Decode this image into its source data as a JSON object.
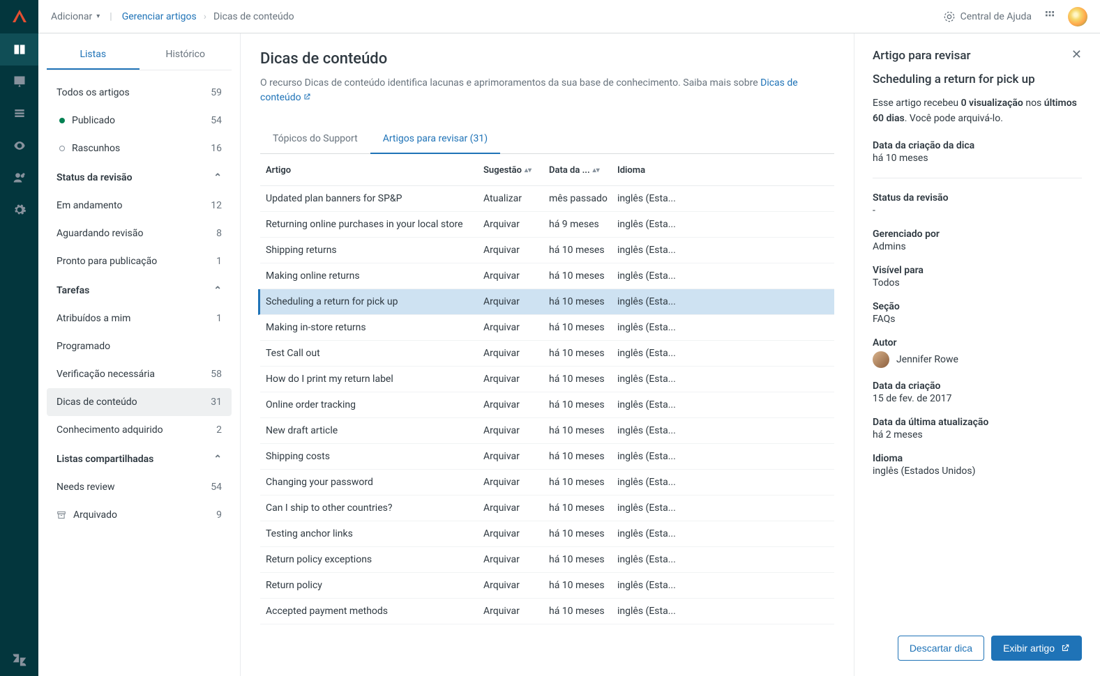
{
  "topbar": {
    "add": "Adicionar",
    "crumb_link": "Gerenciar artigos",
    "crumb_current": "Dicas de conteúdo",
    "help": "Central de Ajuda"
  },
  "sidebar": {
    "tab_lists": "Listas",
    "tab_history": "Histórico",
    "all": {
      "label": "Todos os artigos",
      "count": "59"
    },
    "published": {
      "label": "Publicado",
      "count": "54"
    },
    "drafts": {
      "label": "Rascunhos",
      "count": "16"
    },
    "group_review": "Status da revisão",
    "in_progress": {
      "label": "Em andamento",
      "count": "12"
    },
    "awaiting": {
      "label": "Aguardando revisão",
      "count": "8"
    },
    "ready": {
      "label": "Pronto para publicação",
      "count": "1"
    },
    "group_tasks": "Tarefas",
    "assigned": {
      "label": "Atribuídos a mim",
      "count": "1"
    },
    "scheduled": {
      "label": "Programado",
      "count": ""
    },
    "verify": {
      "label": "Verificação necessária",
      "count": "58"
    },
    "cues": {
      "label": "Dicas de conteúdo",
      "count": "31"
    },
    "acquired": {
      "label": "Conhecimento adquirido",
      "count": "2"
    },
    "group_shared": "Listas compartilhadas",
    "needs_review": {
      "label": "Needs review",
      "count": "54"
    },
    "archived": {
      "label": "Arquivado",
      "count": "9"
    }
  },
  "center": {
    "title": "Dicas de conteúdo",
    "desc_1": "O recurso Dicas de conteúdo identifica lacunas e aprimoramentos da sua base de conhecimento. Saiba mais sobre ",
    "desc_link": "Dicas de conteúdo",
    "tab_support": "Tópicos do Support",
    "tab_review": "Artigos para revisar (31)",
    "th_article": "Artigo",
    "th_suggestion": "Sugestão",
    "th_date": "Data da ...",
    "th_lang": "Idioma",
    "rows": [
      {
        "a": "Updated plan banners for SP&P",
        "s": "Atualizar",
        "d": "mês passado",
        "l": "inglês (Esta..."
      },
      {
        "a": "Returning online purchases in your local store",
        "s": "Arquivar",
        "d": "há 9 meses",
        "l": "inglês (Esta..."
      },
      {
        "a": "Shipping returns",
        "s": "Arquivar",
        "d": "há 10 meses",
        "l": "inglês (Esta..."
      },
      {
        "a": "Making online returns",
        "s": "Arquivar",
        "d": "há 10 meses",
        "l": "inglês (Esta..."
      },
      {
        "a": "Scheduling a return for pick up",
        "s": "Arquivar",
        "d": "há 10 meses",
        "l": "inglês (Esta...",
        "selected": true
      },
      {
        "a": "Making in-store returns",
        "s": "Arquivar",
        "d": "há 10 meses",
        "l": "inglês (Esta..."
      },
      {
        "a": "Test Call out",
        "s": "Arquivar",
        "d": "há 10 meses",
        "l": "inglês (Esta..."
      },
      {
        "a": "How do I print my return label",
        "s": "Arquivar",
        "d": "há 10 meses",
        "l": "inglês (Esta..."
      },
      {
        "a": "Online order tracking",
        "s": "Arquivar",
        "d": "há 10 meses",
        "l": "inglês (Esta..."
      },
      {
        "a": "New draft article",
        "s": "Arquivar",
        "d": "há 10 meses",
        "l": "inglês (Esta..."
      },
      {
        "a": "Shipping costs",
        "s": "Arquivar",
        "d": "há 10 meses",
        "l": "inglês (Esta..."
      },
      {
        "a": "Changing your password",
        "s": "Arquivar",
        "d": "há 10 meses",
        "l": "inglês (Esta..."
      },
      {
        "a": "Can I ship to other countries?",
        "s": "Arquivar",
        "d": "há 10 meses",
        "l": "inglês (Esta..."
      },
      {
        "a": "Testing anchor links",
        "s": "Arquivar",
        "d": "há 10 meses",
        "l": "inglês (Esta..."
      },
      {
        "a": "Return policy exceptions",
        "s": "Arquivar",
        "d": "há 10 meses",
        "l": "inglês (Esta..."
      },
      {
        "a": "Return policy",
        "s": "Arquivar",
        "d": "há 10 meses",
        "l": "inglês (Esta..."
      },
      {
        "a": "Accepted payment methods",
        "s": "Arquivar",
        "d": "há 10 meses",
        "l": "inglês (Esta..."
      }
    ]
  },
  "detail": {
    "panel_title": "Artigo para revisar",
    "article_title": "Scheduling a return for pick up",
    "p1_a": "Esse artigo recebeu ",
    "p1_b": "0 visualização",
    "p1_c": " nos ",
    "p1_d": "últimos 60 dias",
    "p1_e": ". Você pode arquivá-lo.",
    "f_created_cue": "Data da criação da dica",
    "v_created_cue": "há 10 meses",
    "f_review_status": "Status da revisão",
    "v_review_status": "-",
    "f_managed": "Gerenciado por",
    "v_managed": "Admins",
    "f_visible": "Visível para",
    "v_visible": "Todos",
    "f_section": "Seção",
    "v_section": "FAQs",
    "f_author": "Autor",
    "v_author": "Jennifer Rowe",
    "f_created": "Data da criação",
    "v_created": "15 de fev. de 2017",
    "f_updated": "Data da última atualização",
    "v_updated": "há 2 meses",
    "f_lang": "Idioma",
    "v_lang": "inglês (Estados Unidos)",
    "btn_discard": "Descartar dica",
    "btn_view": "Exibir artigo"
  }
}
